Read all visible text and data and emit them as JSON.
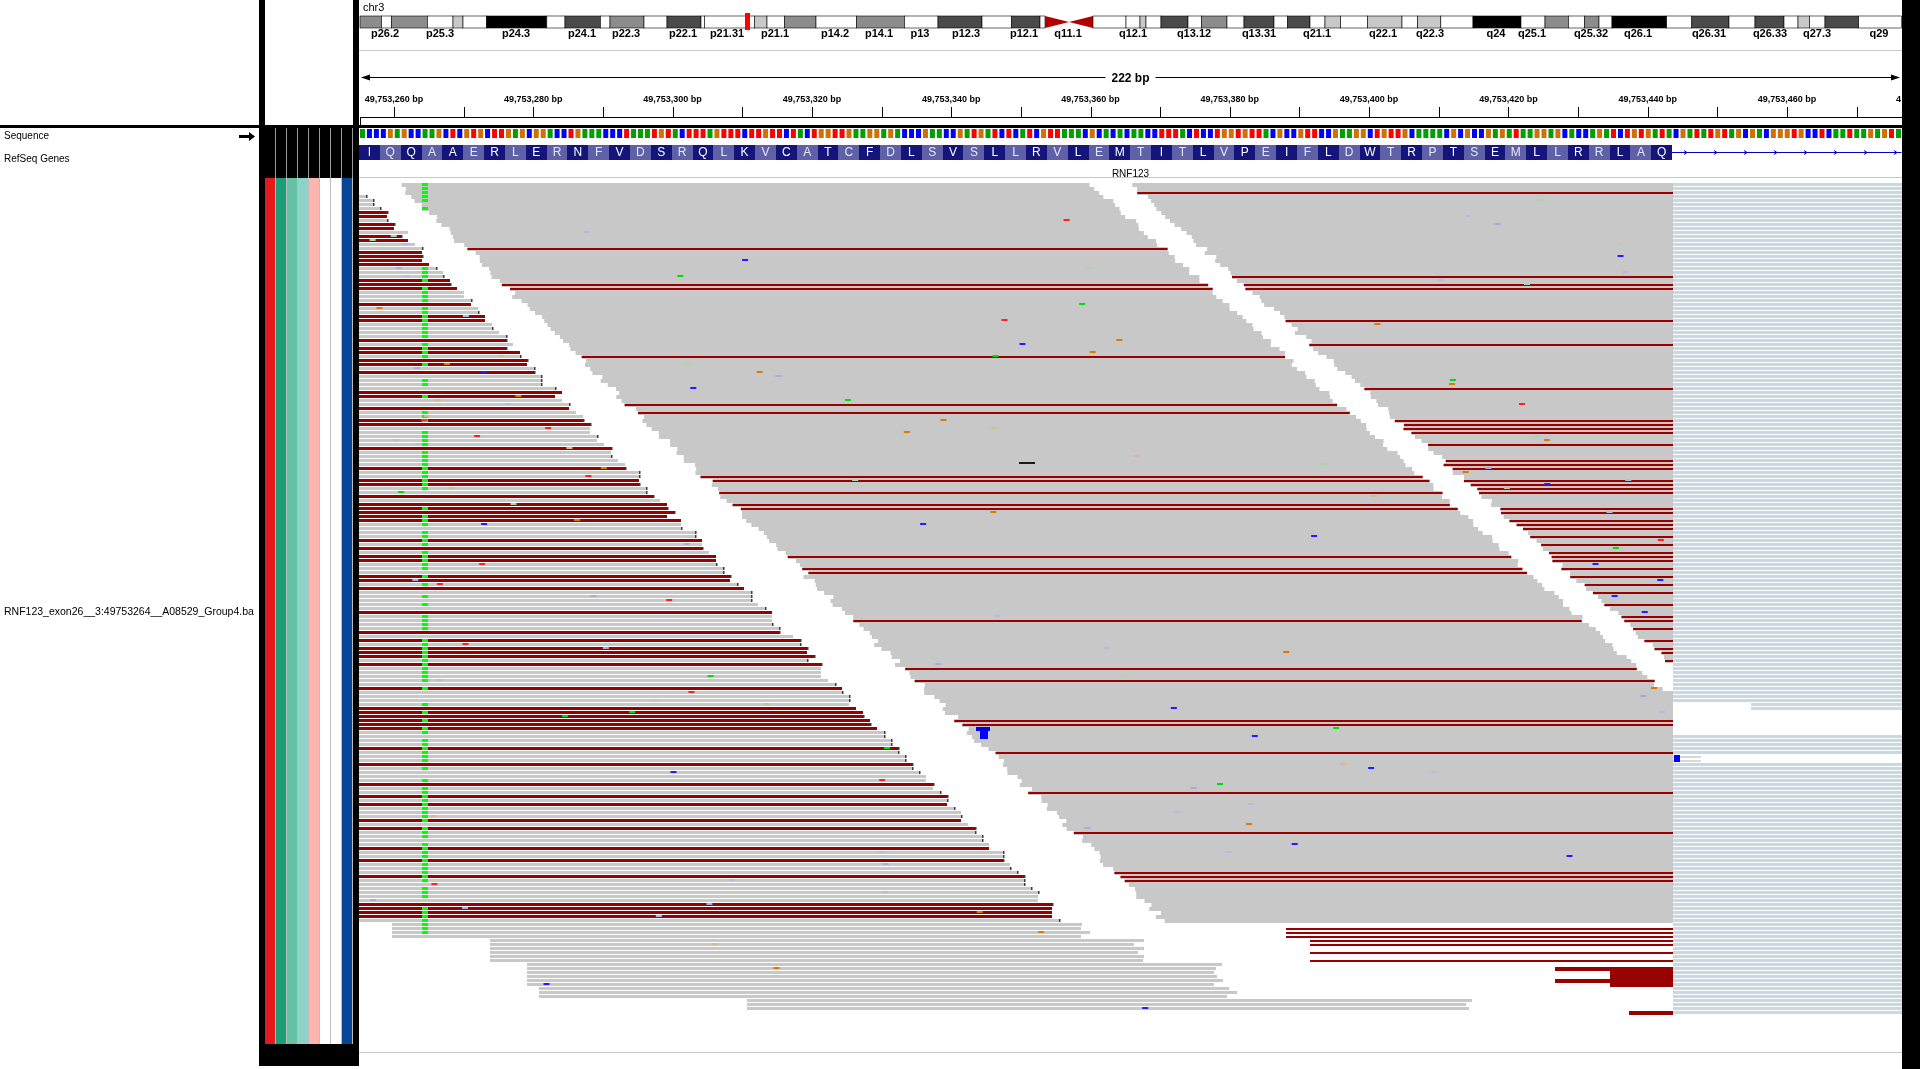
{
  "header": {
    "chromosome": "chr3",
    "band_labels": [
      "p26.2",
      "p25.3",
      "p24.3",
      "p24.1",
      "p22.3",
      "p22.1",
      "p21.31",
      "p21.1",
      "p14.2",
      "p14.1",
      "p13",
      "p12.3",
      "p12.1",
      "q11.1",
      "q12.1",
      "q13.12",
      "q13.31",
      "q21.1",
      "q22.1",
      "q22.3",
      "q24",
      "q25.1",
      "q25.32",
      "q26.1",
      "q26.31",
      "q26.33",
      "q27.3",
      "q29"
    ],
    "ruler": {
      "span": "222 bp",
      "tick_labels": [
        "49,753,260 bp",
        "49,753,280 bp",
        "49,753,300 bp",
        "49,753,320 bp",
        "49,753,340 bp",
        "49,753,360 bp",
        "49,753,380 bp",
        "49,753,400 bp",
        "49,753,420 bp",
        "49,753,440 bp",
        "49,753,460 bp",
        "4"
      ]
    }
  },
  "tracks": [
    {
      "kind": "sequence",
      "name": "Sequence"
    },
    {
      "kind": "gene",
      "name": "RefSeq Genes",
      "gene": "RNF123",
      "amino_acids": [
        "I",
        "Q",
        "Q",
        "A",
        "A",
        "E",
        "R",
        "L",
        "E",
        "R",
        "N",
        "F",
        "V",
        "D",
        "S",
        "R",
        "Q",
        "L",
        "K",
        "V",
        "C",
        "A",
        "T",
        "C",
        "F",
        "D",
        "L",
        "S",
        "V",
        "S",
        "L",
        "L",
        "R",
        "V",
        "L",
        "E",
        "M",
        "T",
        "I",
        "T",
        "L",
        "V",
        "P",
        "E",
        "I",
        "F",
        "L",
        "D",
        "W",
        "T",
        "R",
        "P",
        "T",
        "S",
        "E",
        "M",
        "L",
        "L",
        "R",
        "R",
        "L",
        "A",
        "Q"
      ]
    },
    {
      "kind": "alignment",
      "name": "RNF123_exon26__3:49753264__A08529_Group4.ba"
    }
  ],
  "attributes": [
    {
      "color": "#e41a1c"
    },
    {
      "color": "#1b9e77"
    },
    {
      "color": "#66c2a5"
    },
    {
      "color": "#8dd3c7"
    },
    {
      "color": "#fbb4ae"
    },
    {
      "color": "#ffffff"
    },
    {
      "color": "#ffffff"
    },
    {
      "color": "#084594"
    }
  ]
}
